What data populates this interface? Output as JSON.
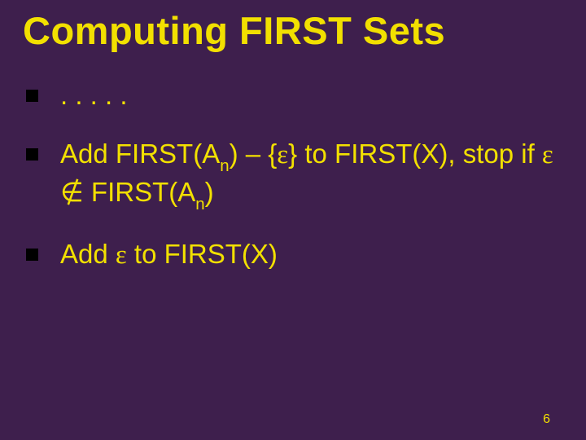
{
  "title": "Computing FIRST Sets",
  "bullets": {
    "b1": ". . . . .",
    "b2_pre": "Add FIRST(A",
    "b2_sub1": "n",
    "b2_mid1": ") – {",
    "b2_eps1": "ε",
    "b2_mid2": "} to FIRST(X), stop if ",
    "b2_eps2": "ε",
    "b2_sp": " ",
    "b2_notin": "∉",
    "b2_mid3": " FIRST(A",
    "b2_sub2": "n",
    "b2_end": ")",
    "b3_pre": "Add ",
    "b3_eps": "ε",
    "b3_end": " to FIRST(X)"
  },
  "slide_number": "6"
}
